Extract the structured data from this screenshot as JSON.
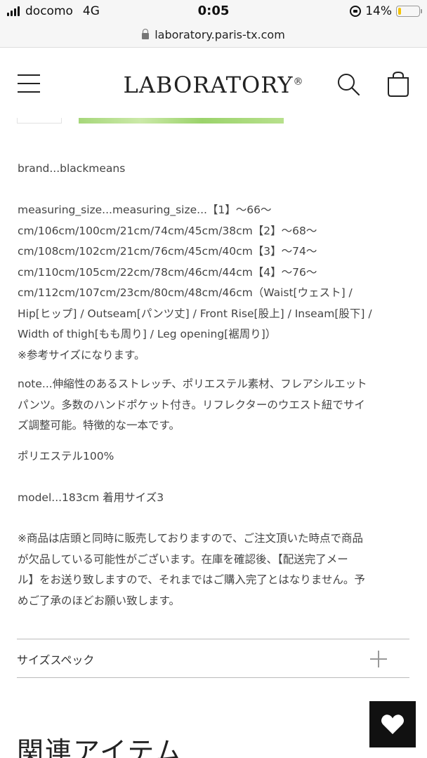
{
  "status_bar": {
    "carrier": "docomo",
    "network": "4G",
    "time": "0:05",
    "battery_percent": "14%",
    "battery_level": 0.14
  },
  "browser": {
    "url": "laboratory.paris-tx.com"
  },
  "header": {
    "logo": "LABORATORY",
    "logo_mark": "®",
    "icons": [
      "menu-icon",
      "search-icon",
      "cart-icon"
    ]
  },
  "description": {
    "brand": "brand...blackmeans",
    "measuring": "measuring_size...measuring_size...【1】～66～\ncm/106cm/100cm/21cm/74cm/45cm/38cm【2】～68～\ncm/108cm/102cm/21cm/76cm/45cm/40cm【3】～74～\ncm/110cm/105cm/22cm/78cm/46cm/44cm【4】～76～\ncm/112cm/107cm/23cm/80cm/48cm/46cm（Waist[ウェスト] /\nHip[ヒップ] / Outseam[パンツ丈] / Front Rise[股上] / Inseam[股下] /\nWidth of thigh[もも周り] / Leg opening[裾周り]）\n※参考サイズになります。",
    "note": "note...伸縮性のあるストレッチ、ポリエステル素材、フレアシルエット\nパンツ。多数のハンドポケット付き。リフレクターのウエスト紐でサイ\nズ調整可能。特徴的な一本です。",
    "material": "ポリエステル100%",
    "model": "model...183cm 着用サイズ3",
    "notice": "※商品は店頭と同時に販売しておりますので、ご注文頂いた時点で商品\nが欠品している可能性がございます。在庫を確認後、【配送完了メー\nル】をお送り致しますので、それまではご購入完了とはなりません。予\nめご了承のほどお願い致します。"
  },
  "size_spec": {
    "label": "サイズスペック"
  },
  "related": {
    "heading": "関連アイテム"
  },
  "colors": {
    "text": "#444444",
    "battery": "#f5c400",
    "fav_bg": "#111111"
  }
}
